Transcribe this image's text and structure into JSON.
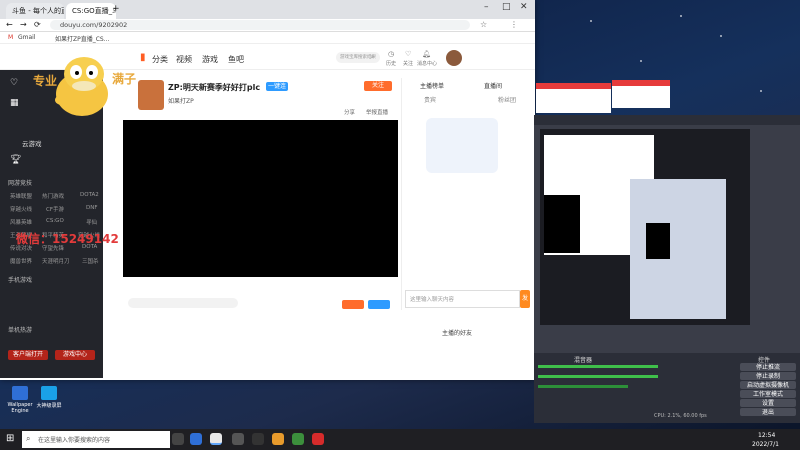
{
  "browser": {
    "tabs": [
      "斗鱼 - 每个人的直播",
      "CS:GO直播_斗鱼直播"
    ],
    "url": "douyu.com/9202902",
    "bookmarks": [
      "Gmail",
      "如果打ZP直播_CS..."
    ]
  },
  "nav": {
    "items": [
      "分类",
      "视频",
      "游戏",
      "鱼吧"
    ],
    "search": "游戏宝库搜索结果",
    "icons": [
      "历史",
      "关注",
      "消息中心"
    ]
  },
  "room": {
    "title": "ZP:明天新赛季好好打plc",
    "streamer": "如果打ZP",
    "btn_follow": "关注",
    "share": "分享",
    "report": "举报直播",
    "open": "一键连"
  },
  "side": {
    "title": "云游戏",
    "sec1": "网游竞技",
    "sec2": "手机游戏",
    "sec3": "单机热游",
    "cols": [
      "英雄联盟",
      "热门游戏",
      "DOTA2",
      "穿越火线",
      "CF手游",
      "DNF",
      "风暴英雄",
      "CS:GO",
      "寻仙",
      "王者荣耀",
      "和平精英",
      "穿越火线",
      "传说对决",
      "守望先锋",
      "DOTA",
      "魔兽世界",
      "天涯明月刀",
      "三国杀"
    ],
    "btn1": "客户端打开",
    "btn2": "游戏中心"
  },
  "watermark": {
    "left": "专业",
    "right": "满子",
    "phone": "微信：15249142"
  },
  "chat": {
    "tab1": "主播榜单",
    "tab2": "贵宾",
    "tab3": "粉丝团",
    "tab4": "直播间",
    "placeholder": "这里输入聊天内容",
    "send": "发送",
    "friends": "主播的好友"
  },
  "taskbar": {
    "search": "在这里输入你要搜索的内容",
    "time": "12:54",
    "date": "2022/7/1"
  },
  "obs": {
    "mixer": "混音器",
    "controls": "控件",
    "buttons": [
      "停止推流",
      "停止录制",
      "启动虚拟摄像机",
      "工作室模式",
      "设置",
      "退出"
    ],
    "status": "CPU: 2.1%, 60.00 fps"
  },
  "desktop": {
    "icons": [
      "Wallpaper Engine",
      "大神级录屏"
    ]
  }
}
